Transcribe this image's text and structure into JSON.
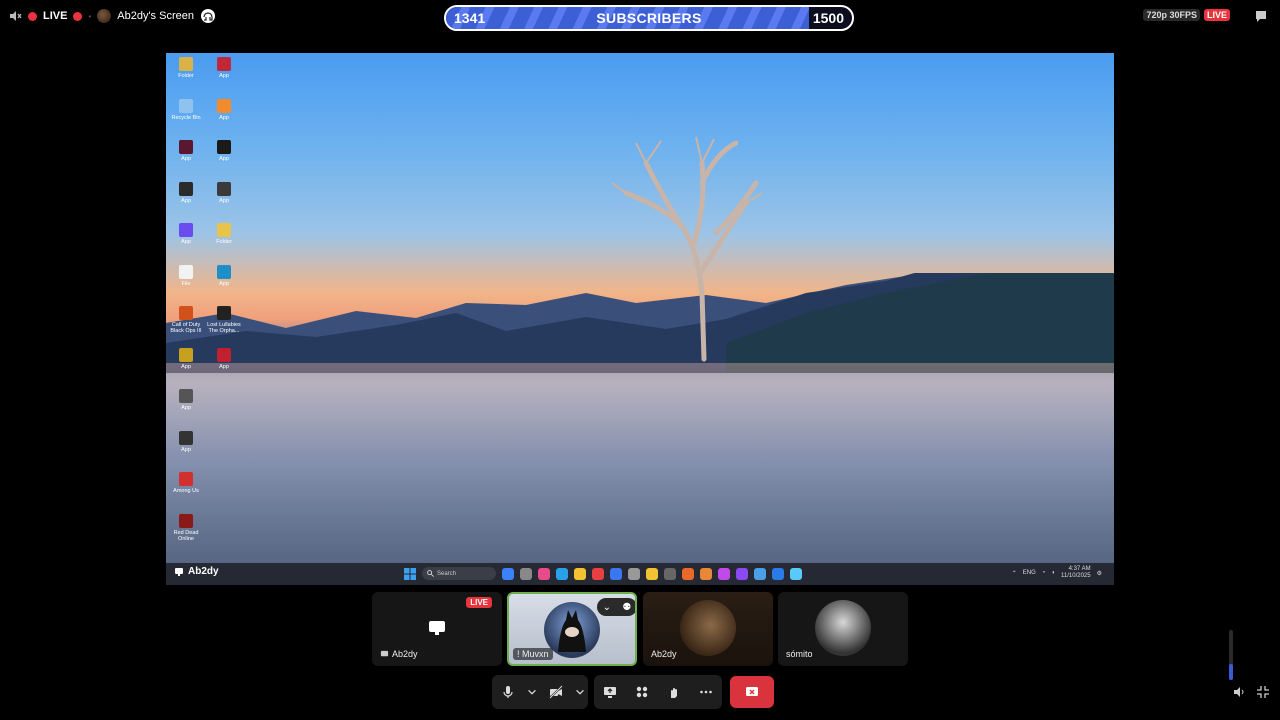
{
  "topbar": {
    "live_label": "LIVE",
    "screen_label": "Ab2dy's Screen",
    "subscribers": {
      "current": "1341",
      "goal": "1500",
      "label": "SUBSCRIBERS",
      "progress": 0.894
    },
    "quality": "720p 30FPS",
    "live_badge": "LIVE"
  },
  "desktop": {
    "icons": [
      {
        "label": "Folder",
        "color": "#d9b24a"
      },
      {
        "label": "App",
        "color": "#c0283a"
      },
      {
        "label": "Recycle Bin",
        "color": "#8fc2f0"
      },
      {
        "label": "App",
        "color": "#f28a2e"
      },
      {
        "label": "App",
        "color": "#5a1830"
      },
      {
        "label": "App",
        "color": "#1a1a1a"
      },
      {
        "label": "App",
        "color": "#2b2b2b"
      },
      {
        "label": "App",
        "color": "#3a3a3a"
      },
      {
        "label": "App",
        "color": "#6a4cf0"
      },
      {
        "label": "Folder",
        "color": "#e8c44a"
      },
      {
        "label": "File",
        "color": "#f2f2f2"
      },
      {
        "label": "App",
        "color": "#1e8fc8"
      },
      {
        "label": "Call of Duty Black Ops III",
        "color": "#d2501c"
      },
      {
        "label": "Lost Lullabies The Orpha...",
        "color": "#222"
      },
      {
        "label": "App",
        "color": "#c8a020"
      },
      {
        "label": "App",
        "color": "#c02030"
      },
      {
        "label": "App",
        "color": "#555"
      },
      {
        "label": "App",
        "color": "#333"
      },
      {
        "label": "Among Us",
        "color": "#d23030"
      },
      {
        "label": "Red Dead Online",
        "color": "#8a1a1a"
      }
    ],
    "taskbar": {
      "user": "Ab2dy",
      "search": "Search",
      "lang": "ENG",
      "time": "4:37 AM",
      "date": "11/10/2025",
      "app_colors": [
        "#3b82f6",
        "#888",
        "#e84b8a",
        "#2aa0e8",
        "#f2c230",
        "#e84040",
        "#3b78f0",
        "#999",
        "#f2c230",
        "#666",
        "#e86a2a",
        "#e8873a",
        "#c04ae8",
        "#8a4af0",
        "#4aa0e8",
        "#2a7ae8",
        "#5ac8fa"
      ]
    }
  },
  "participants": [
    {
      "name": "Ab2dy",
      "type": "screen",
      "live": "LIVE"
    },
    {
      "name": "! Muvxn",
      "type": "avatar",
      "active": true
    },
    {
      "name": "Ab2dy",
      "type": "avatar"
    },
    {
      "name": "sómito",
      "type": "avatar"
    }
  ],
  "controls": [
    "mic",
    "mic-options",
    "camera-off",
    "camera-options",
    "share-screen",
    "activities",
    "raise-hand",
    "more",
    "leave"
  ]
}
